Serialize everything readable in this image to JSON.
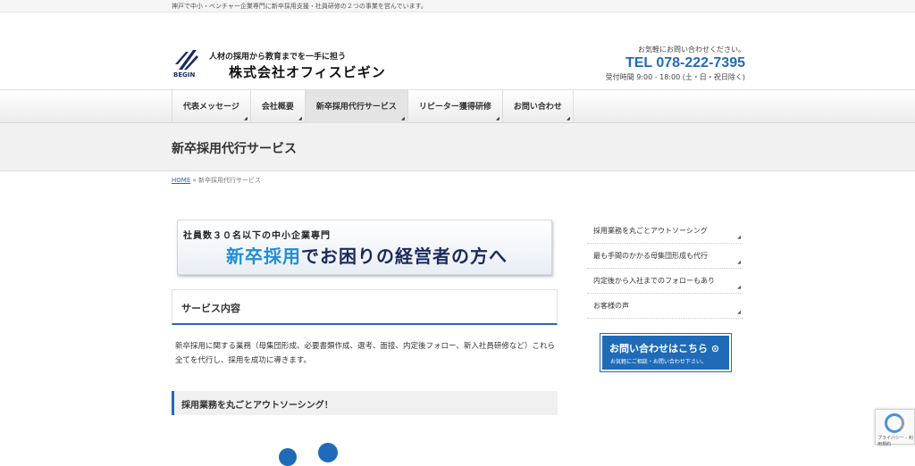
{
  "topbar": {
    "text": "神戸で中小・ベンチャー企業専門に新卒採用支援・社員研修の２つの事業を営んでいます。"
  },
  "header": {
    "logo_text": "BEGIN",
    "tagline": "人材の採用から教育までを一手に担う",
    "company": "株式会社オフィスビギン",
    "contact_note": "お気軽にお問い合わせください。",
    "tel": "TEL 078-222-7395",
    "hours": "受付時間 9:00 - 18:00 (土・日・祝日除く)"
  },
  "nav": {
    "items": [
      {
        "label": "代表メッセージ"
      },
      {
        "label": "会社概要"
      },
      {
        "label": "新卒採用代行サービス"
      },
      {
        "label": "リピーター獲得研修"
      },
      {
        "label": "お問い合わせ"
      }
    ]
  },
  "page": {
    "title": "新卒採用代行サービス"
  },
  "breadcrumb": {
    "home": "HOME",
    "separator": " » ",
    "current": "新卒採用代行サービス"
  },
  "banner": {
    "small": "社員数３０名以下の中小企業専門",
    "big_highlight": "新卒採用",
    "big_rest": "でお困りの経営者の方へ"
  },
  "service": {
    "heading": "サービス内容",
    "description": "新卒採用に関する業務（母集団形成、必要書類作成、選考、面接、内定後フォロー、新入社員研修など）これら全てを代行し、採用を成功に導きます。",
    "subheading": "採用業務を丸ごとアウトソーシング！"
  },
  "sidebar": {
    "items": [
      {
        "label": "採用業務を丸ごとアウトソーシング"
      },
      {
        "label": "最も手間のかかる母集団形成も代行"
      },
      {
        "label": "内定後から入社までのフォローもあり"
      },
      {
        "label": "お客様の声"
      }
    ],
    "cta_main": "お問い合わせはこちら ⊙",
    "cta_sub": "お気軽にご相談・お問い合わせ下さい。"
  },
  "recaptcha": {
    "text": "プライバシー - 利用規約"
  },
  "colors": {
    "accent": "#1f6bb8",
    "navy": "#1a2a5e",
    "highlight": "#1f8ed6"
  }
}
